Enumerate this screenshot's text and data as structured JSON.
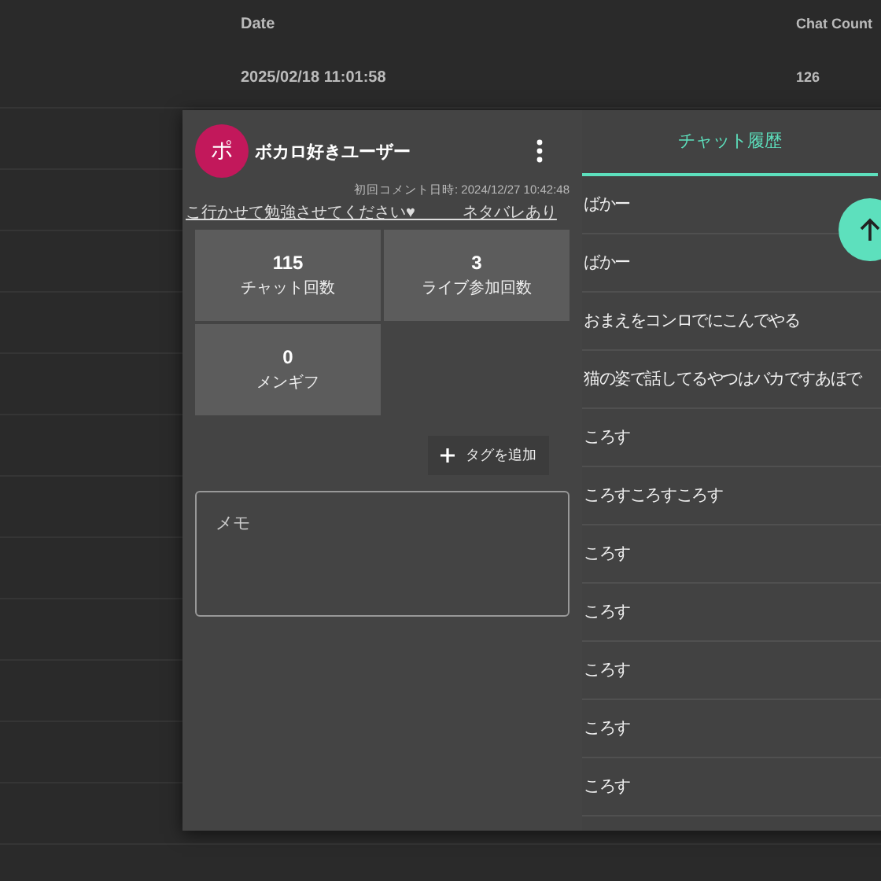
{
  "table": {
    "columns": [
      "Date",
      "Chat Count"
    ],
    "rows": [
      {
        "date": "2025/02/18 11:01:58",
        "chat_count": "126"
      }
    ]
  },
  "dialog": {
    "avatar": "ポ",
    "user_name": "ボカロ好きユーザー",
    "first_comment": "初回コメント日時: 2024/12/27 10:42:48",
    "bio": "こ行かせて勉強させてください♥　　　ネタバレあり",
    "stats": [
      {
        "value": "115",
        "label": "チャット回数"
      },
      {
        "value": "3",
        "label": "ライブ参加回数"
      },
      {
        "value": "0",
        "label": "メンギフ"
      }
    ],
    "add_tag": "タグを追加",
    "memo": {
      "placeholder": "メモ"
    },
    "tabs": [
      {
        "label": "チャット履歴",
        "selected": true
      }
    ],
    "chat_history": [
      "ばかー",
      "ばかー",
      "おまえをコンロでにこんでやる",
      "猫の姿で話してるやつはバカですあほで",
      "ころす",
      "ころすころすころす",
      "ころす",
      "ころす",
      "ころす",
      "ころす",
      "ころす"
    ]
  }
}
